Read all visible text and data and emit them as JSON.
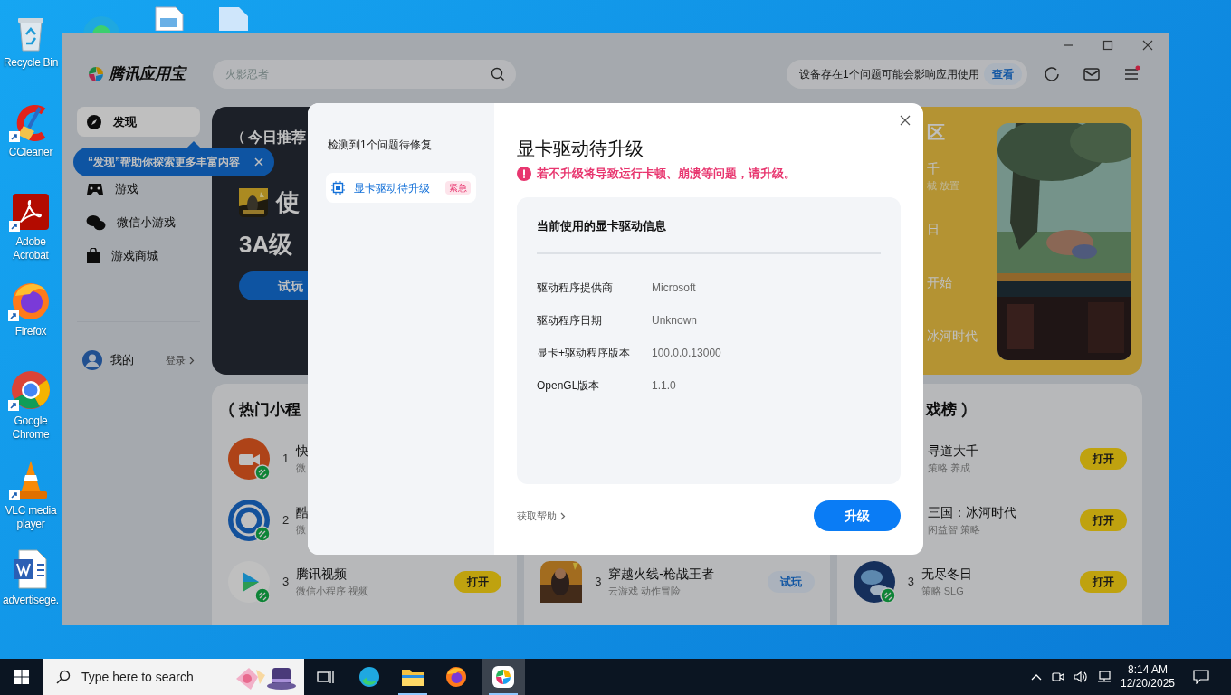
{
  "desktop": {
    "top_icons": [
      {
        "kind": "edge"
      },
      {
        "kind": "image_file"
      },
      {
        "kind": "file"
      }
    ],
    "shortcuts": [
      {
        "label": "Recycle Bin",
        "kind": "recycle",
        "shortcut": false
      },
      {
        "label": "CCleaner",
        "kind": "ccleaner",
        "shortcut": true
      },
      {
        "label": "Adobe Acrobat",
        "kind": "acrobat",
        "shortcut": true
      },
      {
        "label": "Firefox",
        "kind": "firefox",
        "shortcut": true
      },
      {
        "label": "Google Chrome",
        "kind": "chrome",
        "shortcut": true
      },
      {
        "label": "VLC media player",
        "kind": "vlc",
        "shortcut": true
      },
      {
        "label": "advertisege.",
        "kind": "word",
        "shortcut": false
      }
    ]
  },
  "app": {
    "logo": "腾讯应用宝",
    "search": {
      "placeholder": "火影忍者"
    },
    "notice": {
      "text": "设备存在1个问题可能会影响应用使用",
      "action": "查看"
    },
    "menu_alert": true,
    "sidebar": {
      "items": [
        {
          "label": "发现",
          "kind": "compass",
          "selected": true
        },
        {
          "label": "游戏",
          "kind": "gamepad",
          "selected": false
        },
        {
          "label": "微信小游戏",
          "kind": "chat",
          "selected": false
        },
        {
          "label": "游戏商城",
          "kind": "bag",
          "selected": false
        }
      ],
      "tooltip": "“发现”帮助你探索更多丰富内容",
      "account": {
        "label": "我的",
        "action": "登录"
      }
    },
    "banner": {
      "heading": "今日推荐",
      "game": "使",
      "tagline": "3A级",
      "button": "试玩"
    },
    "feature": {
      "heading": "区",
      "items": [
        {
          "title": "千",
          "meta": "械 放置"
        },
        {
          "title": "日"
        },
        {
          "title": "开始"
        },
        {
          "title": "冰河时代"
        }
      ]
    },
    "lists": [
      {
        "title": "热门小程",
        "rows": [
          {
            "rank": "1",
            "name": "快",
            "meta": "微",
            "kind": "camera",
            "mini_program": true
          },
          {
            "rank": "2",
            "name": "酷",
            "meta": "微",
            "kind": "ring",
            "mini_program": true
          },
          {
            "rank": "3",
            "name": "腾讯视频",
            "meta": "微信小程序 视频",
            "kind": "play",
            "mini_program": true,
            "button": {
              "label": "打开",
              "kind": "open"
            }
          }
        ]
      },
      {
        "rows": [
          {
            "rank": "3",
            "name": "穿越火线-枪战王者",
            "meta": "云游戏 动作冒险",
            "kind": "game",
            "mini_program": false,
            "button": {
              "label": "试玩",
              "kind": "trial"
            }
          }
        ]
      },
      {
        "title": "戏榜",
        "rows": [
          {
            "name": "寻道大千",
            "meta": "策略 养成",
            "button": {
              "label": "打开",
              "kind": "open"
            }
          },
          {
            "name": "三国：冰河时代",
            "meta": "闲益智 策略",
            "button": {
              "label": "打开",
              "kind": "open"
            }
          },
          {
            "rank": "3",
            "name": "无尽冬日",
            "meta": "策略 SLG",
            "kind": "globe",
            "mini_program": true,
            "button": {
              "label": "打开",
              "kind": "open"
            }
          }
        ]
      }
    ]
  },
  "dialog": {
    "sidebar_title": "检测到1个问题待修复",
    "issues": [
      {
        "label": "显卡驱动待升级",
        "badge": "紧急",
        "selected": true
      }
    ],
    "title": "显卡驱动待升级",
    "warning": "若不升级将导致运行卡顿、崩溃等问题，请升级。",
    "info": {
      "heading": "当前使用的显卡驱动信息",
      "rows": [
        {
          "label": "驱动程序提供商",
          "value": "Microsoft"
        },
        {
          "label": "驱动程序日期",
          "value": "Unknown"
        },
        {
          "label": "显卡+驱动程序版本",
          "value": "100.0.0.13000"
        },
        {
          "label": "OpenGL版本",
          "value": "1.1.0"
        }
      ]
    },
    "help_link": "获取帮助",
    "primary_button": "升级"
  },
  "taskbar": {
    "search_placeholder": "Type here to search",
    "apps": [
      {
        "kind": "task_view",
        "running": false,
        "active": false
      },
      {
        "kind": "edge",
        "running": false,
        "active": false
      },
      {
        "kind": "explorer",
        "running": true,
        "active": false
      },
      {
        "kind": "firefox",
        "running": false,
        "active": false
      },
      {
        "kind": "appstore",
        "running": true,
        "active": true
      }
    ],
    "time": "8:14 AM",
    "date": "12/20/2025"
  }
}
